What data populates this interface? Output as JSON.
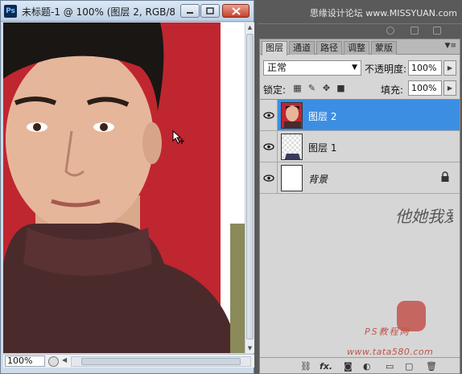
{
  "document": {
    "title": "未标题-1 @ 100% (图层 2, RGB/8...",
    "app_badge": "Ps",
    "zoom": "100%"
  },
  "top_watermark": "思缘设计论坛 www.MISSYUAN.com",
  "layers_panel": {
    "tabs": [
      {
        "label": "图层",
        "active": true
      },
      {
        "label": "通道",
        "active": false
      },
      {
        "label": "路径",
        "active": false
      },
      {
        "label": "调整",
        "active": false
      },
      {
        "label": "蒙版",
        "active": false
      }
    ],
    "blend_mode": "正常",
    "opacity_label": "不透明度:",
    "opacity_value": "100%",
    "lock_label": "锁定:",
    "fill_label": "填充:",
    "fill_value": "100%",
    "layers": [
      {
        "name": "图层 2",
        "selected": true,
        "visible": true
      },
      {
        "name": "图层 1",
        "selected": false,
        "visible": true
      },
      {
        "name": "背景",
        "selected": false,
        "visible": true,
        "locked": true
      }
    ],
    "footer_fx": "fx."
  },
  "watermark": {
    "signature": "他她我爱你",
    "ps_label": "PS教程网",
    "url": "www.tata580.com"
  },
  "colors": {
    "selection": "#3c8ee3",
    "photo_background": "#c0262f",
    "sweater": "#4b2a2c"
  }
}
